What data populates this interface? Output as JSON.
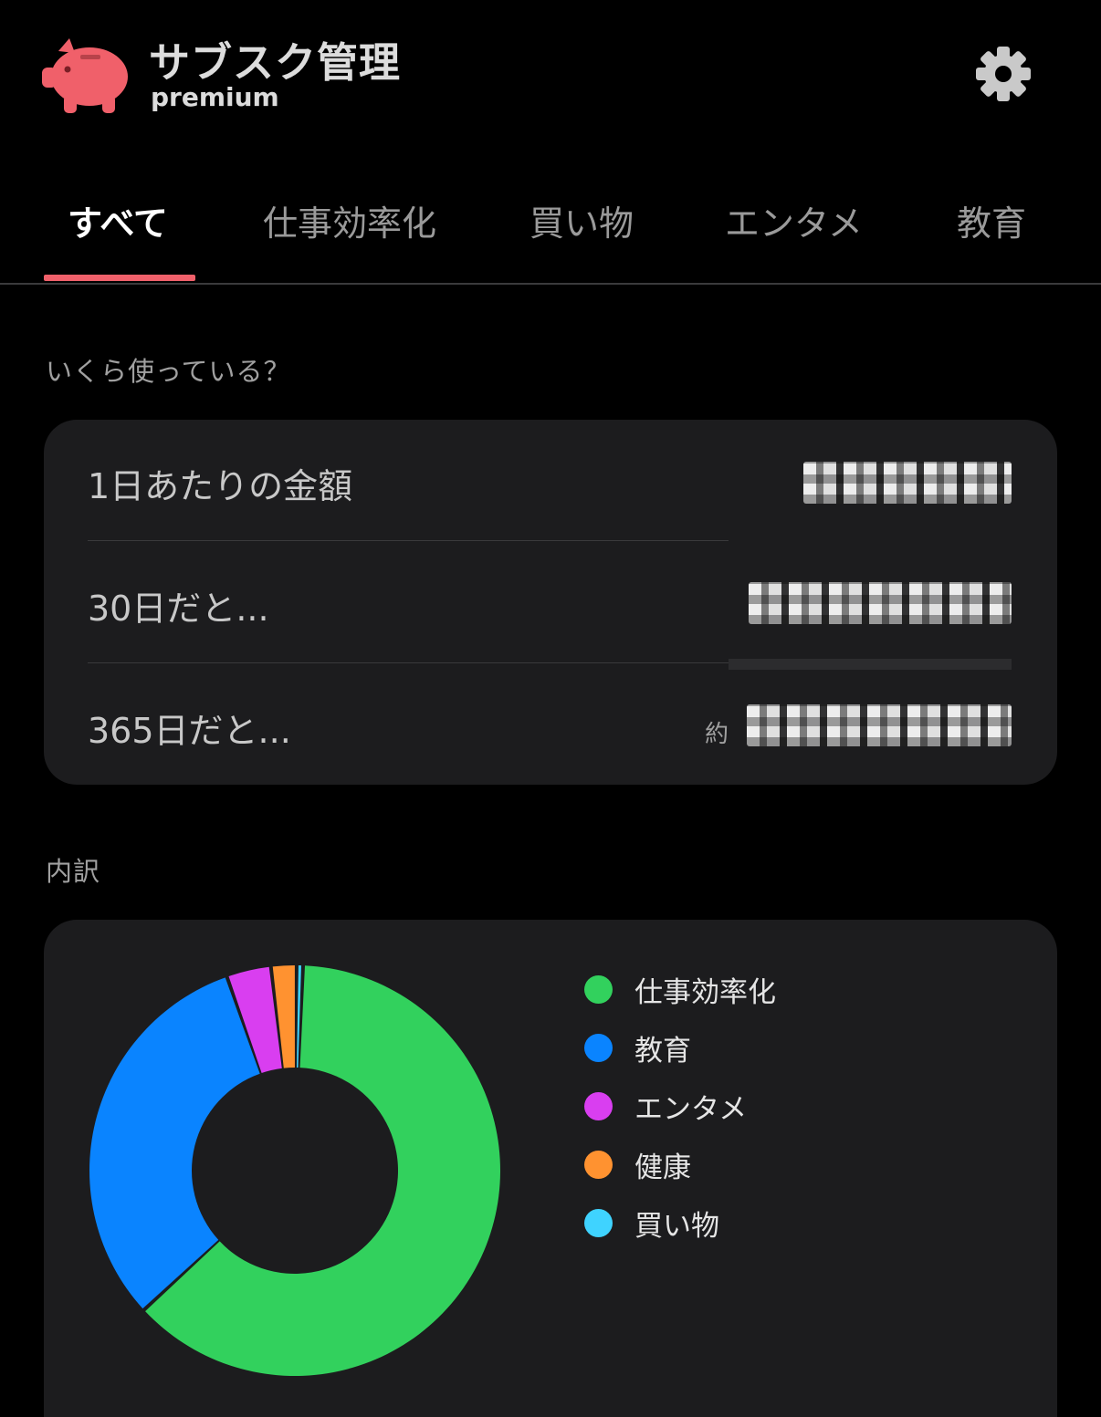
{
  "header": {
    "app_title": "サブスク管理",
    "app_subtitle": "premium",
    "logo_icon": "piggy-bank-icon",
    "settings_icon": "gear-icon"
  },
  "colors": {
    "accent": "#f0606a",
    "background": "#000000",
    "card": "#1c1c1e"
  },
  "tabs": [
    {
      "label": "すべて",
      "active": true
    },
    {
      "label": "仕事効率化",
      "active": false
    },
    {
      "label": "買い物",
      "active": false
    },
    {
      "label": "エンタメ",
      "active": false
    },
    {
      "label": "教育",
      "active": false
    }
  ],
  "summary": {
    "section_label": "いくら使っている？",
    "rows": [
      {
        "label": "1日あたりの金額"
      },
      {
        "label": "30日だと..."
      },
      {
        "label": "365日だと...",
        "prefix": "約"
      }
    ]
  },
  "breakdown": {
    "section_label": "内訳"
  },
  "chart_data": {
    "type": "pie",
    "title": "",
    "series": [
      {
        "name": "仕事効率化",
        "value": 62.5,
        "color": "#32d15d"
      },
      {
        "name": "教育",
        "value": 31.5,
        "color": "#0a84ff"
      },
      {
        "name": "エンタメ",
        "value": 3.5,
        "color": "#d93ef0"
      },
      {
        "name": "健康",
        "value": 2.0,
        "color": "#ff9230"
      },
      {
        "name": "買い物",
        "value": 0.5,
        "color": "#3fd3ff"
      }
    ],
    "legend_position": "right",
    "donut": true
  }
}
